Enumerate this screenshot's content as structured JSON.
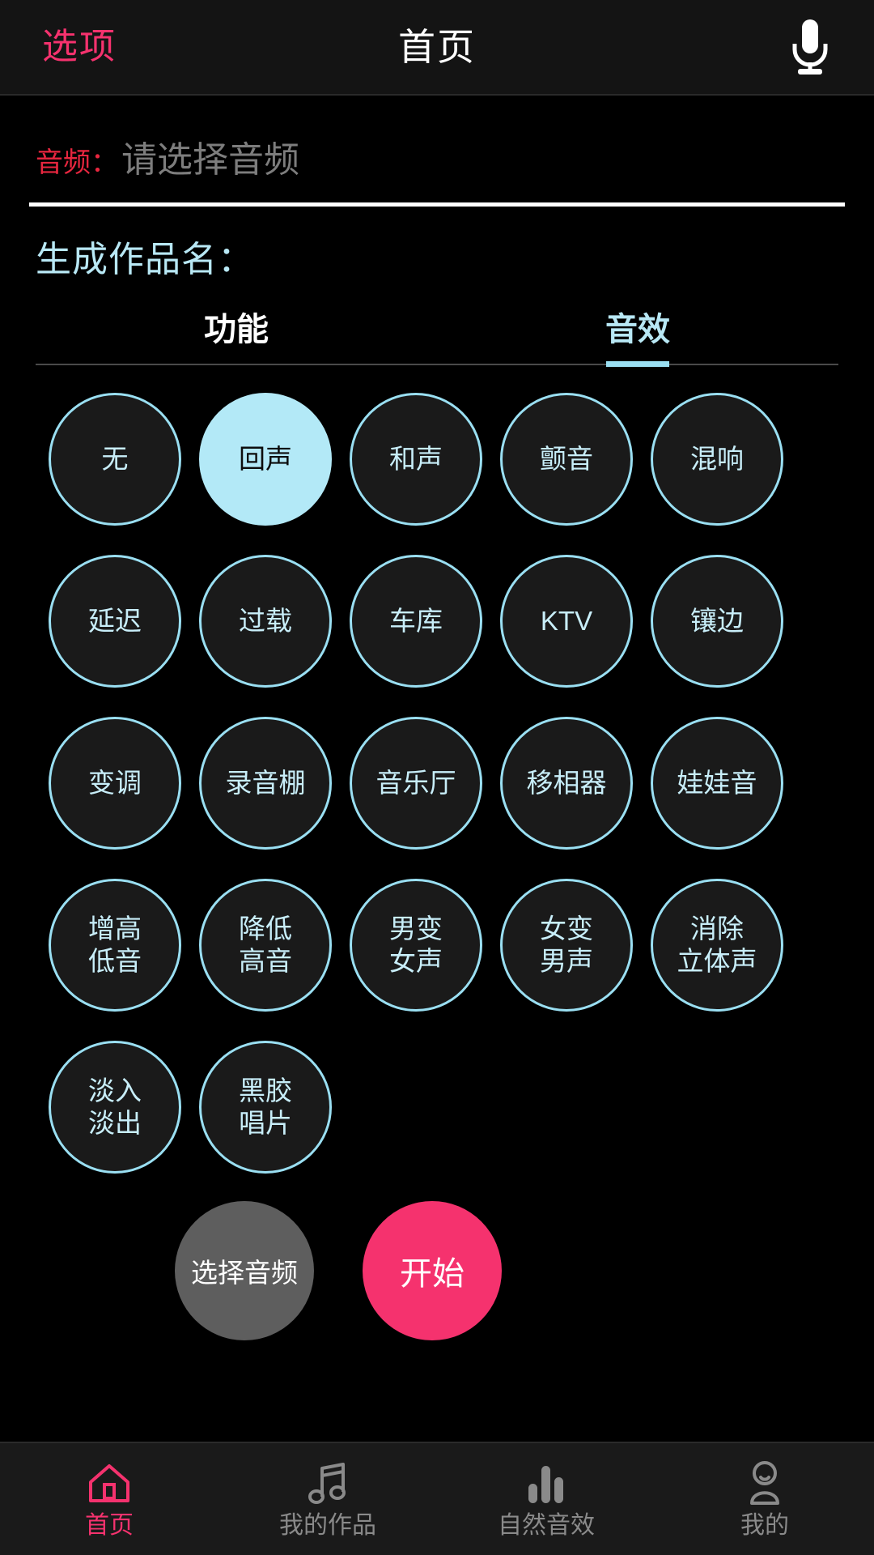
{
  "topbar": {
    "left_action": "选项",
    "title": "首页",
    "mic_icon": "microphone-icon"
  },
  "audio_field": {
    "label": "音频：",
    "placeholder": "请选择音频",
    "value": ""
  },
  "work_name": {
    "label": "生成作品名："
  },
  "tabs": [
    {
      "label": "功能",
      "active": false
    },
    {
      "label": "音效",
      "active": true
    }
  ],
  "effects": [
    {
      "label": "无",
      "selected": false
    },
    {
      "label": "回声",
      "selected": true
    },
    {
      "label": "和声",
      "selected": false
    },
    {
      "label": "颤音",
      "selected": false
    },
    {
      "label": "混响",
      "selected": false
    },
    {
      "label": "延迟",
      "selected": false
    },
    {
      "label": "过载",
      "selected": false
    },
    {
      "label": "车库",
      "selected": false
    },
    {
      "label": "KTV",
      "selected": false
    },
    {
      "label": "镶边",
      "selected": false
    },
    {
      "label": "变调",
      "selected": false
    },
    {
      "label": "录音棚",
      "selected": false
    },
    {
      "label": "音乐厅",
      "selected": false
    },
    {
      "label": "移相器",
      "selected": false
    },
    {
      "label": "娃娃音",
      "selected": false
    },
    {
      "label": "增高\n低音",
      "selected": false
    },
    {
      "label": "降低\n高音",
      "selected": false
    },
    {
      "label": "男变\n女声",
      "selected": false
    },
    {
      "label": "女变\n男声",
      "selected": false
    },
    {
      "label": "消除\n立体声",
      "selected": false
    },
    {
      "label": "淡入\n淡出",
      "selected": false
    },
    {
      "label": "黑胶\n唱片",
      "selected": false
    }
  ],
  "actions": {
    "select_audio": "选择音频",
    "start": "开始"
  },
  "bottom_nav": [
    {
      "label": "首页",
      "icon": "home-icon",
      "active": true
    },
    {
      "label": "我的作品",
      "icon": "music-note-icon",
      "active": false
    },
    {
      "label": "自然音效",
      "icon": "bar-chart-icon",
      "active": false
    },
    {
      "label": "我的",
      "icon": "person-icon",
      "active": false
    }
  ],
  "colors": {
    "accent_pink": "#f5326e",
    "accent_cyan": "#9adff2",
    "selected_fill": "#b3e9f7",
    "background": "#000000",
    "chip_fill": "#1a1a1a",
    "placeholder_gray": "#7d7d7d",
    "label_red": "#e8263f"
  }
}
